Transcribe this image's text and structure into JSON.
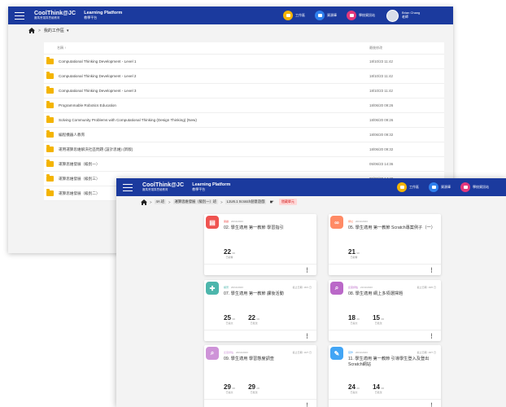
{
  "back": {
    "header": {
      "brand_name": "CoolThink@JC",
      "brand_sub": "賽馬會運算思維教育",
      "platform_en": "Learning Platform",
      "platform_zh": "教學平台",
      "nav": [
        "工作區",
        "資源庫",
        "學校資訊站"
      ],
      "user_name": "Brian Chang",
      "user_role": "老師",
      "colors": {
        "bar": "#1b3a9e",
        "nav1": "#f4b400",
        "nav2": "#2f80ed",
        "nav3": "#e2387c"
      }
    },
    "breadcrumb": {
      "home_icon": "home-icon",
      "current": "我的工作區"
    },
    "list": {
      "col_name": "名稱 ↑",
      "col_date": "最後修改",
      "rows": [
        {
          "name": "Computational Thinking Development - Level 1",
          "date": "18/10/23 11:42"
        },
        {
          "name": "Computational Thinking Development - Level 2",
          "date": "18/10/23 11:42"
        },
        {
          "name": "Computational Thinking Development - Level 3",
          "date": "18/10/23 11:42"
        },
        {
          "name": "Programmable Robotics Education",
          "date": "18/06/20 09:26"
        },
        {
          "name": "Solving Community Problems with Computational Thinking (Design Thinking) (New)",
          "date": "18/06/20 09:26"
        },
        {
          "name": "編程機器人教育",
          "date": "18/06/20 09:32"
        },
        {
          "name": "運用運算思維解決社區問題 (設計思維) (新版)",
          "date": "18/06/20 09:32"
        },
        {
          "name": "運算思維發展（級別一）",
          "date": "05/06/23 14:36"
        },
        {
          "name": "運算思維發展（級別三）",
          "date": "05/06/23 14:49"
        },
        {
          "name": "運算思維發展（級別二）",
          "date": "05/06/23 14:41"
        }
      ]
    }
  },
  "front": {
    "header": {
      "nav": [
        "工作區",
        "資源庫",
        "學校資訊站"
      ]
    },
    "breadcrumb": {
      "items": [
        "4A 班",
        "運算思維發展（級別一）班",
        "L1U6.1 Scratch創意遊戲"
      ],
      "badge": "隱藏單元"
    },
    "cards": [
      {
        "icon": "document-icon",
        "color": "#ef5350",
        "tag": "閱讀",
        "date": "20/11/2023",
        "due": "",
        "title": "02. 學生適用 第一教節 學習指引",
        "stats": [
          {
            "num": "22",
            "den": "/30",
            "label": "已觀看"
          }
        ]
      },
      {
        "icon": "link-icon",
        "color": "#ff8a65",
        "tag": "網址",
        "date": "20/11/2023",
        "due": "",
        "title": "05. 學生適用 第一教節 Scratch專案例子（一）",
        "stats": [
          {
            "num": "21",
            "den": "/30",
            "label": "已觀看"
          }
        ]
      },
      {
        "icon": "puzzle-icon",
        "color": "#4db6ac",
        "tag": "練習",
        "date": "20/11/2023",
        "due": "截止日期: 18/1 日",
        "title": "07. 學生適用 第一教節 課後活動",
        "stats": [
          {
            "num": "25",
            "den": "/30",
            "label": "已提交"
          },
          {
            "num": "22",
            "den": "/30",
            "label": "已批改"
          }
        ]
      },
      {
        "icon": "search-icon",
        "color": "#ba68c8",
        "tag": "反思評估",
        "date": "21/11/2023",
        "due": "截止日期: 18/6 日",
        "title": "08. 學生適用 網上多項選擇題",
        "stats": [
          {
            "num": "18",
            "den": "/30",
            "label": "已提交"
          },
          {
            "num": "15",
            "den": "/30",
            "label": "已批改"
          }
        ]
      },
      {
        "icon": "search-icon",
        "color": "#ce93d8",
        "tag": "反思評估",
        "date": "20/11/2023",
        "due": "截止日期: 19/7 日",
        "title": "09. 學生適用 學習態度調查",
        "stats": [
          {
            "num": "29",
            "den": "/30",
            "label": "已提交"
          },
          {
            "num": "29",
            "den": "/30",
            "label": "已批改"
          }
        ]
      },
      {
        "icon": "pencil-icon",
        "color": "#42a5f5",
        "tag": "寫作",
        "date": "20/11/2023",
        "due": "截止日期: 18/7 日",
        "title": "11. 學生適用 第一教節 引導學生登入及登出Scratch網站",
        "stats": [
          {
            "num": "24",
            "den": "/30",
            "label": "已提交"
          },
          {
            "num": "14",
            "den": "/30",
            "label": "已批改"
          }
        ]
      }
    ]
  }
}
